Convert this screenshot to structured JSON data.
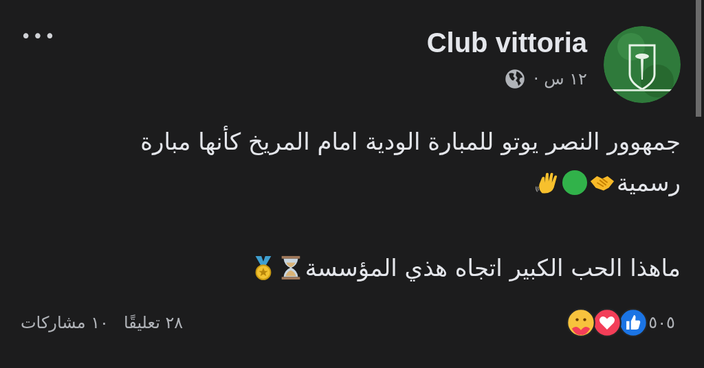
{
  "post": {
    "author": "Club vittoria",
    "time": "١٢ س ·",
    "more_icon": "•••",
    "paragraphs": [
      {
        "lines": [
          "جمهوور النصر يوتو للمبارة الودية امام المريخ كأنها مبارة",
          "رسمية"
        ],
        "emojis": [
          {
            "kind": "handshake"
          },
          {
            "kind": "circle"
          },
          {
            "kind": "wave"
          }
        ]
      },
      {
        "lines": [
          "ماهذا الحب الكبير اتجاه هذي المؤسسة"
        ],
        "emojis": [
          {
            "kind": "hourglass"
          },
          {
            "kind": "medal"
          }
        ]
      }
    ],
    "reactions": {
      "types": [
        {
          "kind": "like"
        },
        {
          "kind": "love"
        },
        {
          "kind": "care"
        }
      ],
      "count": "٥٠٥"
    },
    "comments": "٢٨ تعليقًا",
    "shares": "١٠ مشاركات"
  }
}
